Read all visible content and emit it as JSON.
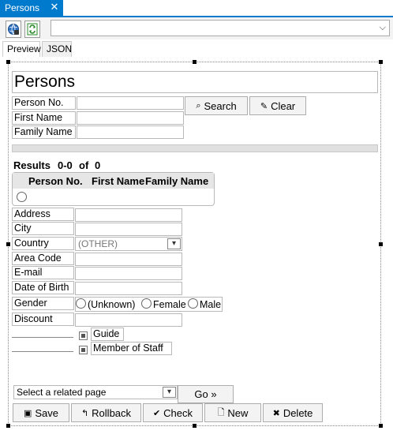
{
  "tab": {
    "title": "Persons",
    "close": "✕"
  },
  "view_tabs": {
    "preview": "Preview",
    "json": "JSON"
  },
  "form": {
    "title": "Persons",
    "search": {
      "person_no_label": "Person No.",
      "first_name_label": "First Name",
      "family_name_label": "Family Name",
      "search_button": "Search",
      "clear_button": "Clear"
    },
    "results": {
      "label": "Results",
      "range": "0-0",
      "of": "of",
      "total": "0",
      "columns": [
        "Person No.",
        "First Name",
        "Family Name"
      ]
    },
    "details": {
      "address": "Address",
      "city": "City",
      "country": "Country",
      "country_value": "(OTHER)",
      "area_code": "Area Code",
      "email": "E-mail",
      "date_of_birth": "Date of Birth",
      "gender": "Gender",
      "gender_options": [
        "(Unknown)",
        "Female",
        "Male"
      ],
      "discount": "Discount",
      "guide": "Guide",
      "member_of_staff": "Member of Staff"
    },
    "related": {
      "placeholder": "Select a related page",
      "go_button": "Go »"
    },
    "actions": {
      "save": "Save",
      "rollback": "Rollback",
      "check": "Check",
      "new": "New",
      "delete": "Delete"
    }
  },
  "colors": {
    "accent": "#007acc"
  }
}
